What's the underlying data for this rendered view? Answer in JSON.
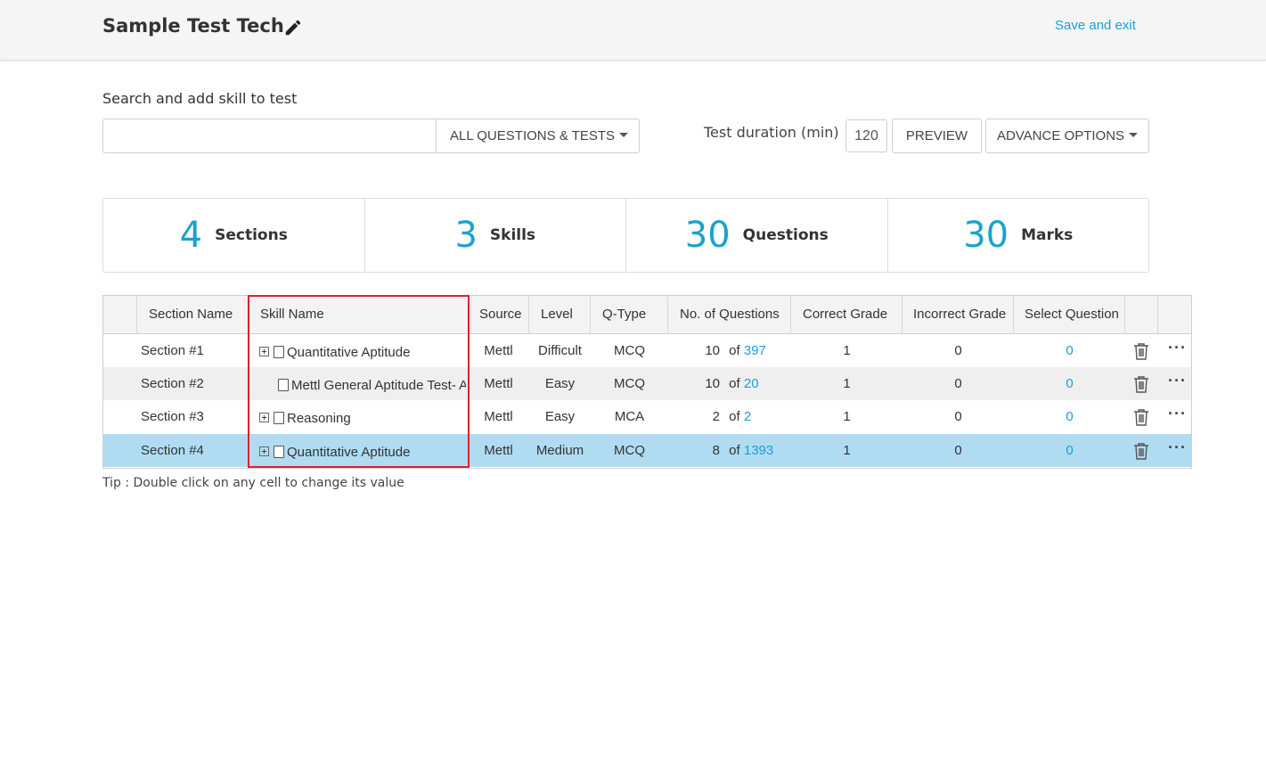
{
  "header": {
    "title": "Sample Test Tech",
    "save_exit_label": "Save and exit",
    "edit_icon": "pencil-icon"
  },
  "search": {
    "label": "Search and add skill to test",
    "value": "",
    "filter_label": "ALL QUESTIONS & TESTS"
  },
  "duration": {
    "label": "Test duration (min)",
    "value": "120"
  },
  "buttons": {
    "preview": "PREVIEW",
    "advance": "ADVANCE OPTIONS"
  },
  "stats": [
    {
      "value": "4",
      "label": "Sections"
    },
    {
      "value": "3",
      "label": "Skills"
    },
    {
      "value": "30",
      "label": "Questions"
    },
    {
      "value": "30",
      "label": "Marks"
    }
  ],
  "table": {
    "columns": [
      "Section Name",
      "Skill Name",
      "Source",
      "Level",
      "Q-Type",
      "No. of  Questions",
      "Correct Grade",
      "Incorrect Grade",
      "Select Question"
    ],
    "rows": [
      {
        "section": "Section #1",
        "skill": "Quantitative Aptitude",
        "expandable": true,
        "source": "Mettl",
        "level": "Difficult",
        "qtype": "MCQ",
        "count": "10",
        "of": "of",
        "total": "397",
        "correct": "1",
        "incorrect": "0",
        "select": "0"
      },
      {
        "section": "Section #2",
        "skill": "Mettl General Aptitude Test- A",
        "expandable": false,
        "source": "Mettl",
        "level": "Easy",
        "qtype": "MCQ",
        "count": "10",
        "of": "of",
        "total": "20",
        "correct": "1",
        "incorrect": "0",
        "select": "0"
      },
      {
        "section": "Section #3",
        "skill": "Reasoning",
        "expandable": true,
        "source": "Mettl",
        "level": "Easy",
        "qtype": "MCA",
        "count": "2",
        "of": "of",
        "total": "2",
        "correct": "1",
        "incorrect": "0",
        "select": "0"
      },
      {
        "section": "Section #4",
        "skill": "Quantitative Aptitude",
        "expandable": true,
        "source": "Mettl",
        "level": "Medium",
        "qtype": "MCQ",
        "count": "8",
        "of": "of",
        "total": "1393",
        "correct": "1",
        "incorrect": "0",
        "select": "0"
      }
    ],
    "row_actions": {
      "delete_icon": "trash-icon",
      "more_icon": "more-dots-icon",
      "more_label": "···"
    }
  },
  "tip": "Tip : Double click on any cell to change its value",
  "colors": {
    "accent": "#1aa3c8",
    "link": "#1a9fd4",
    "selected_row": "#b0dcf2",
    "highlight_box": "#d9232d"
  }
}
